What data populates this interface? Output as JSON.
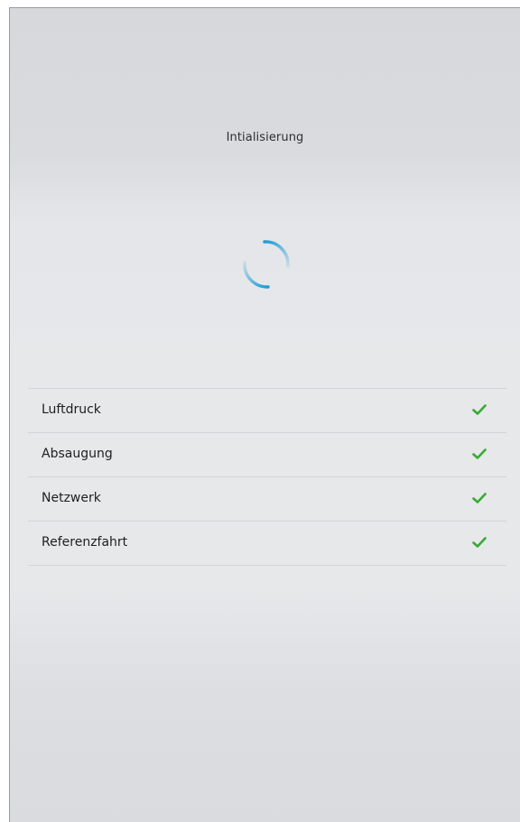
{
  "header": {
    "title": "Intialisierung"
  },
  "spinner": {
    "icon": "loading-spinner-icon",
    "color": "#1a9ad6"
  },
  "status_items": [
    {
      "label": "Luftdruck",
      "status": "ok",
      "icon": "checkmark-icon"
    },
    {
      "label": "Absaugung",
      "status": "ok",
      "icon": "checkmark-icon"
    },
    {
      "label": "Netzwerk",
      "status": "ok",
      "icon": "checkmark-icon"
    },
    {
      "label": "Referenzfahrt",
      "status": "ok",
      "icon": "checkmark-icon"
    }
  ],
  "colors": {
    "check": "#3aa935",
    "spinner": "#1a9ad6",
    "text": "#1f1f1f"
  }
}
